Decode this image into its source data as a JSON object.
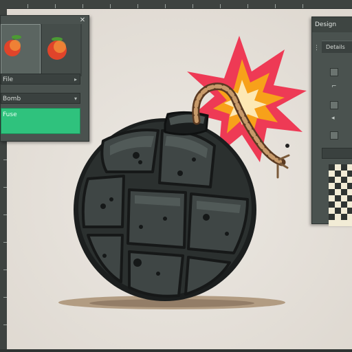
{
  "app": {
    "left_panel": {
      "thumbnails": [
        {
          "icon": "peach-icon"
        },
        {
          "icon": "peach-icon"
        }
      ],
      "fields": [
        {
          "value": "File"
        },
        {
          "value": "Bomb"
        }
      ],
      "action_button": {
        "label": "Fuse"
      }
    },
    "right_panel": {
      "title": "Design",
      "tab_label": "Details"
    }
  },
  "canvas": {
    "artwork": "bomb-illustration"
  }
}
